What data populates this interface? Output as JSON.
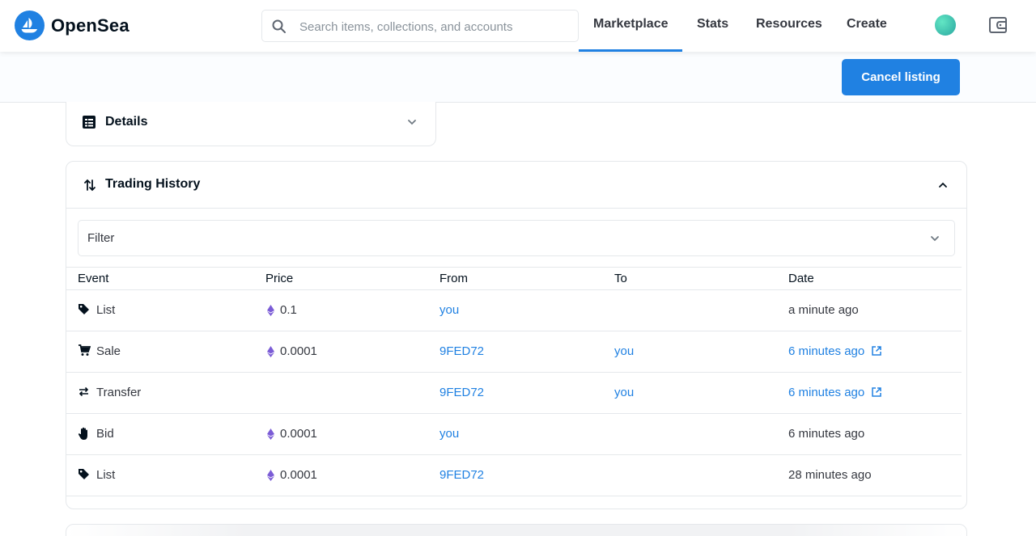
{
  "nav": {
    "brand": "OpenSea",
    "search_placeholder": "Search items, collections, and accounts",
    "items": [
      "Marketplace",
      "Stats",
      "Resources",
      "Create"
    ],
    "active": "Marketplace"
  },
  "action": {
    "cancel_label": "Cancel listing"
  },
  "details": {
    "title": "Details"
  },
  "history": {
    "title": "Trading History",
    "filter_label": "Filter",
    "columns": [
      "Event",
      "Price",
      "From",
      "To",
      "Date"
    ],
    "rows": [
      {
        "event": "List",
        "icon": "tag-icon",
        "price": "0.1",
        "from": "you",
        "to": "",
        "date": "a minute ago",
        "date_link": false
      },
      {
        "event": "Sale",
        "icon": "cart-icon",
        "price": "0.0001",
        "from": "9FED72",
        "to": "you",
        "date": "6 minutes ago",
        "date_link": true
      },
      {
        "event": "Transfer",
        "icon": "transfer-icon",
        "price": "",
        "from": "9FED72",
        "to": "you",
        "date": "6 minutes ago",
        "date_link": true
      },
      {
        "event": "Bid",
        "icon": "hand-icon",
        "price": "0.0001",
        "from": "you",
        "to": "",
        "date": "6 minutes ago",
        "date_link": false
      },
      {
        "event": "List",
        "icon": "tag-icon",
        "price": "0.0001",
        "from": "9FED72",
        "to": "",
        "date": "28 minutes ago",
        "date_link": false
      }
    ]
  },
  "colors": {
    "accent": "#2081e2",
    "eth": "#7b5cd6",
    "text": "#353840",
    "border": "#e5e8eb"
  }
}
